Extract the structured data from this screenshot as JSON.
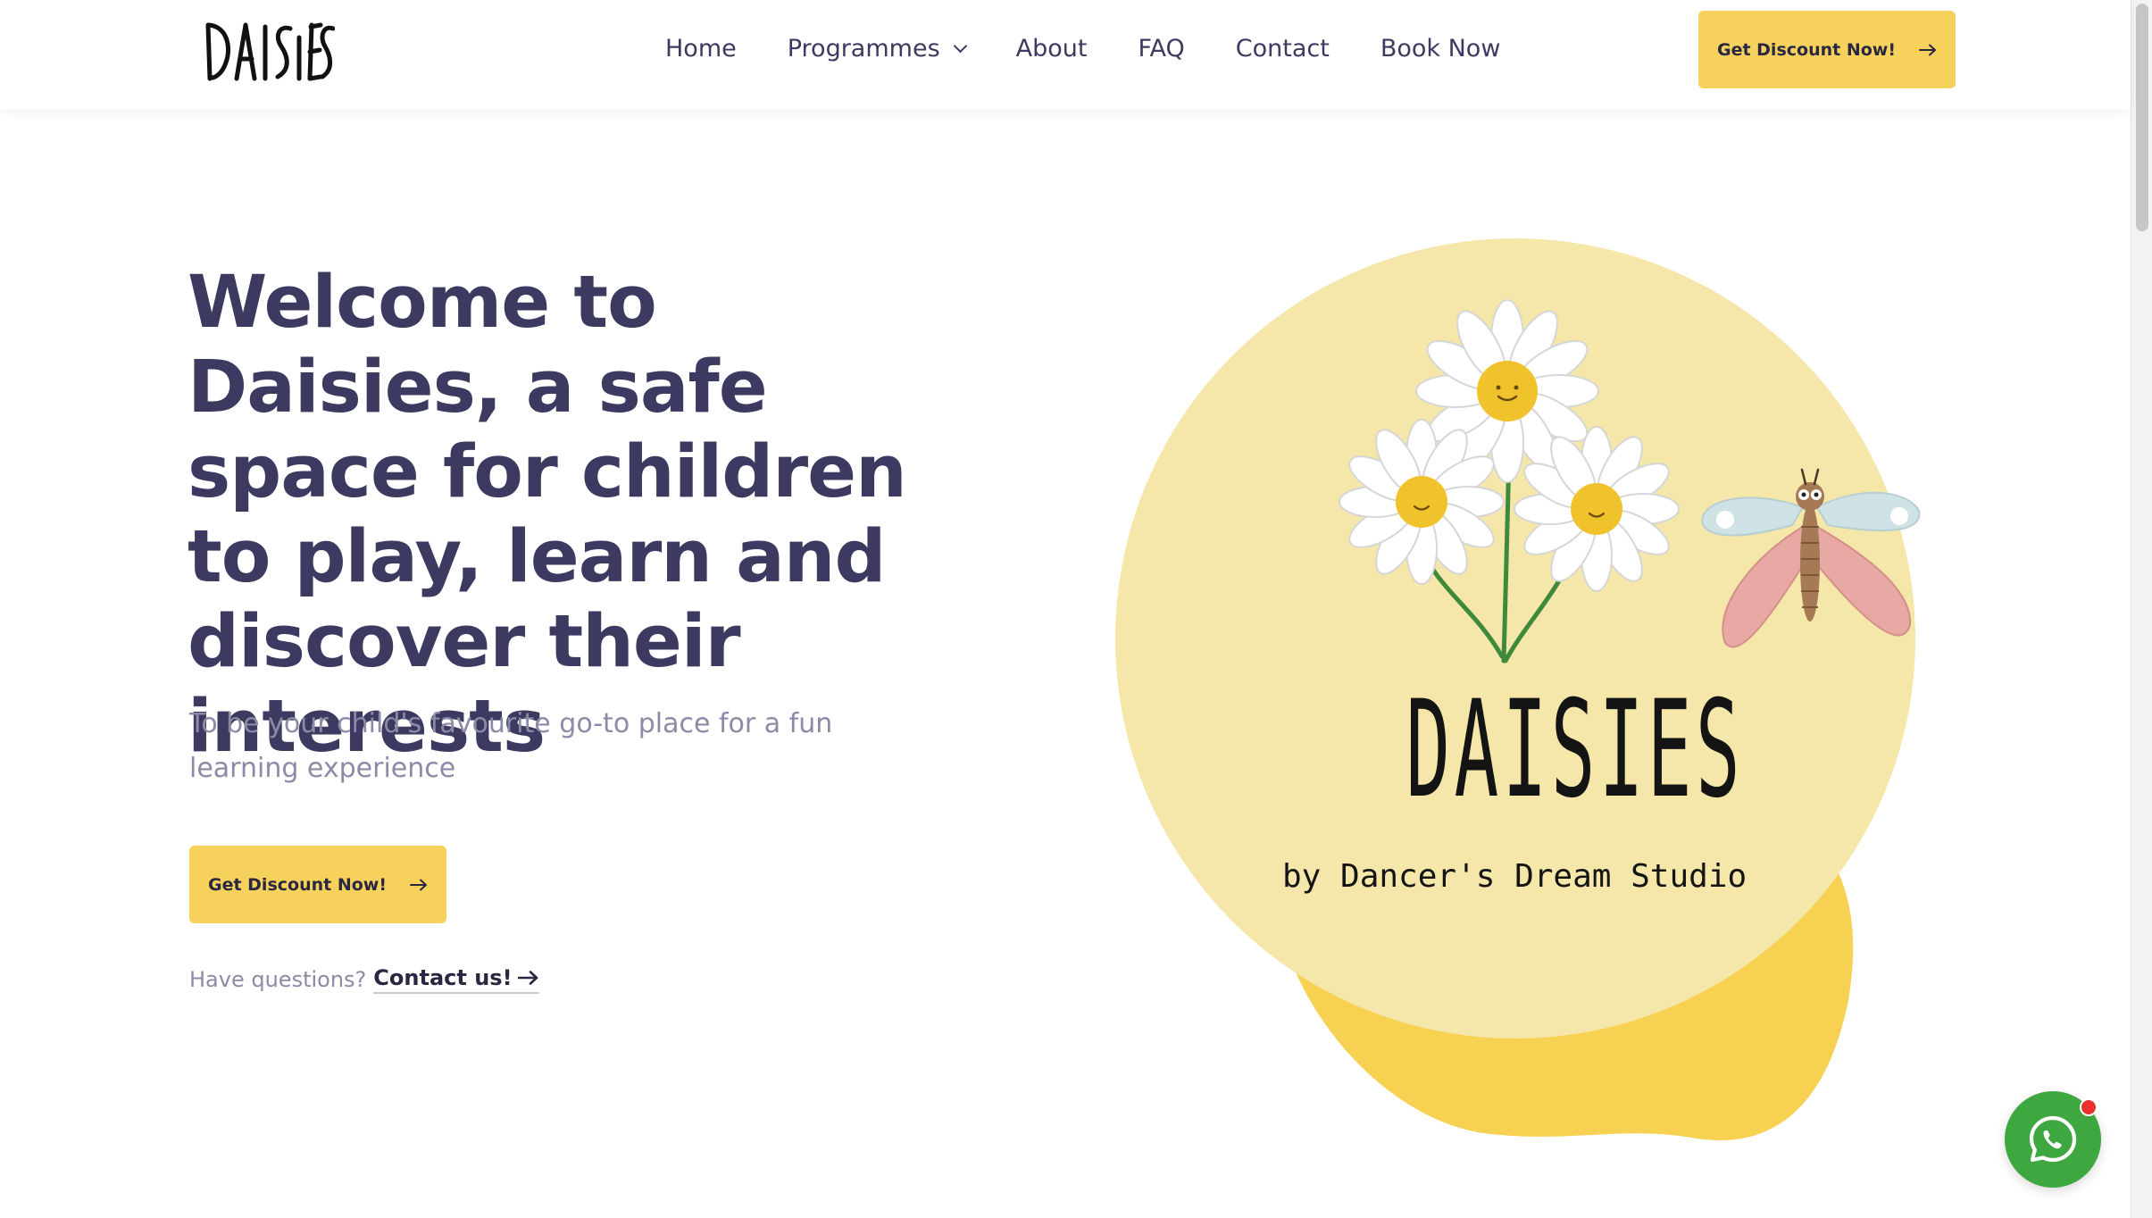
{
  "header": {
    "logo_text": "DAISIES",
    "nav": [
      {
        "label": "Home"
      },
      {
        "label": "Programmes",
        "has_dropdown": true
      },
      {
        "label": "About"
      },
      {
        "label": "FAQ"
      },
      {
        "label": "Contact"
      },
      {
        "label": "Book Now"
      }
    ],
    "cta_label": "Get Discount Now!"
  },
  "hero": {
    "title": "Welcome to Daisies, a safe space for children to play, learn and discover their interests",
    "subtitle": "To be your child's favourite go-to place for a fun learning experience",
    "cta_label": "Get Discount Now!",
    "questions_prefix": "Have questions?",
    "contact_link_label": "Contact us!"
  },
  "illustration": {
    "brand_name": "DAISIES",
    "tagline": "by Dancer's Dream Studio",
    "elements": [
      "daisy-flowers",
      "butterfly"
    ]
  },
  "floating": {
    "whatsapp_icon": "whatsapp-icon"
  },
  "colors": {
    "accent": "#f6d25d",
    "heading": "#3c3a60",
    "body_muted": "#8c8aa6",
    "circle": "#f5e6a9",
    "blob": "#f7d152",
    "whatsapp": "#3ea73f"
  }
}
